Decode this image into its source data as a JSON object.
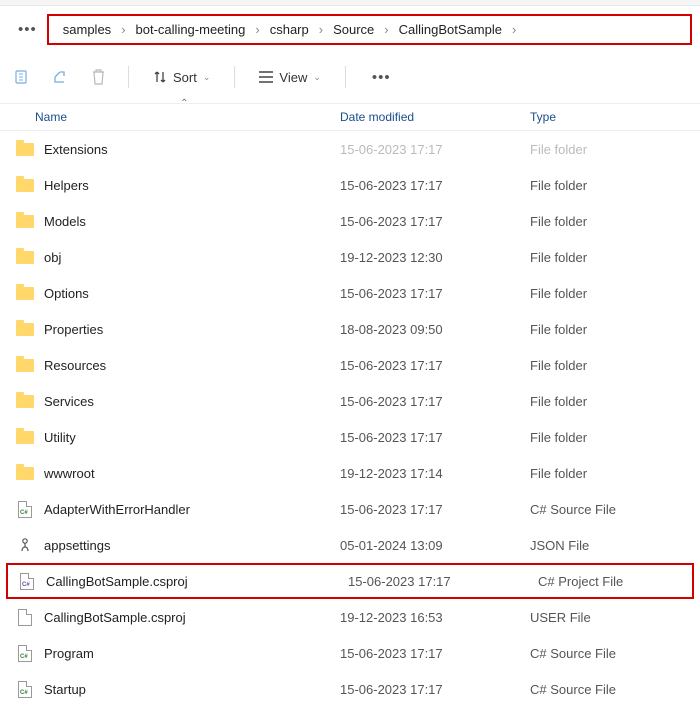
{
  "breadcrumb": [
    "samples",
    "bot-calling-meeting",
    "csharp",
    "Source",
    "CallingBotSample"
  ],
  "toolbar": {
    "sort_label": "Sort",
    "view_label": "View"
  },
  "columns": {
    "name": "Name",
    "date": "Date modified",
    "type": "Type"
  },
  "rows": [
    {
      "icon": "folder",
      "name": "Extensions",
      "date": "15-06-2023 17:17",
      "type": "File folder",
      "faded": true
    },
    {
      "icon": "folder",
      "name": "Helpers",
      "date": "15-06-2023 17:17",
      "type": "File folder"
    },
    {
      "icon": "folder",
      "name": "Models",
      "date": "15-06-2023 17:17",
      "type": "File folder"
    },
    {
      "icon": "folder",
      "name": "obj",
      "date": "19-12-2023 12:30",
      "type": "File folder"
    },
    {
      "icon": "folder",
      "name": "Options",
      "date": "15-06-2023 17:17",
      "type": "File folder"
    },
    {
      "icon": "folder",
      "name": "Properties",
      "date": "18-08-2023 09:50",
      "type": "File folder"
    },
    {
      "icon": "folder",
      "name": "Resources",
      "date": "15-06-2023 17:17",
      "type": "File folder"
    },
    {
      "icon": "folder",
      "name": "Services",
      "date": "15-06-2023 17:17",
      "type": "File folder"
    },
    {
      "icon": "folder",
      "name": "Utility",
      "date": "15-06-2023 17:17",
      "type": "File folder"
    },
    {
      "icon": "folder",
      "name": "wwwroot",
      "date": "19-12-2023 17:14",
      "type": "File folder"
    },
    {
      "icon": "cs",
      "name": "AdapterWithErrorHandler",
      "date": "15-06-2023 17:17",
      "type": "C# Source File"
    },
    {
      "icon": "json",
      "name": "appsettings",
      "date": "05-01-2024 13:09",
      "type": "JSON File"
    },
    {
      "icon": "proj",
      "name": "CallingBotSample.csproj",
      "date": "15-06-2023 17:17",
      "type": "C# Project File",
      "highlight": true
    },
    {
      "icon": "file",
      "name": "CallingBotSample.csproj",
      "date": "19-12-2023 16:53",
      "type": "USER File"
    },
    {
      "icon": "cs",
      "name": "Program",
      "date": "15-06-2023 17:17",
      "type": "C# Source File"
    },
    {
      "icon": "cs",
      "name": "Startup",
      "date": "15-06-2023 17:17",
      "type": "C# Source File"
    }
  ]
}
